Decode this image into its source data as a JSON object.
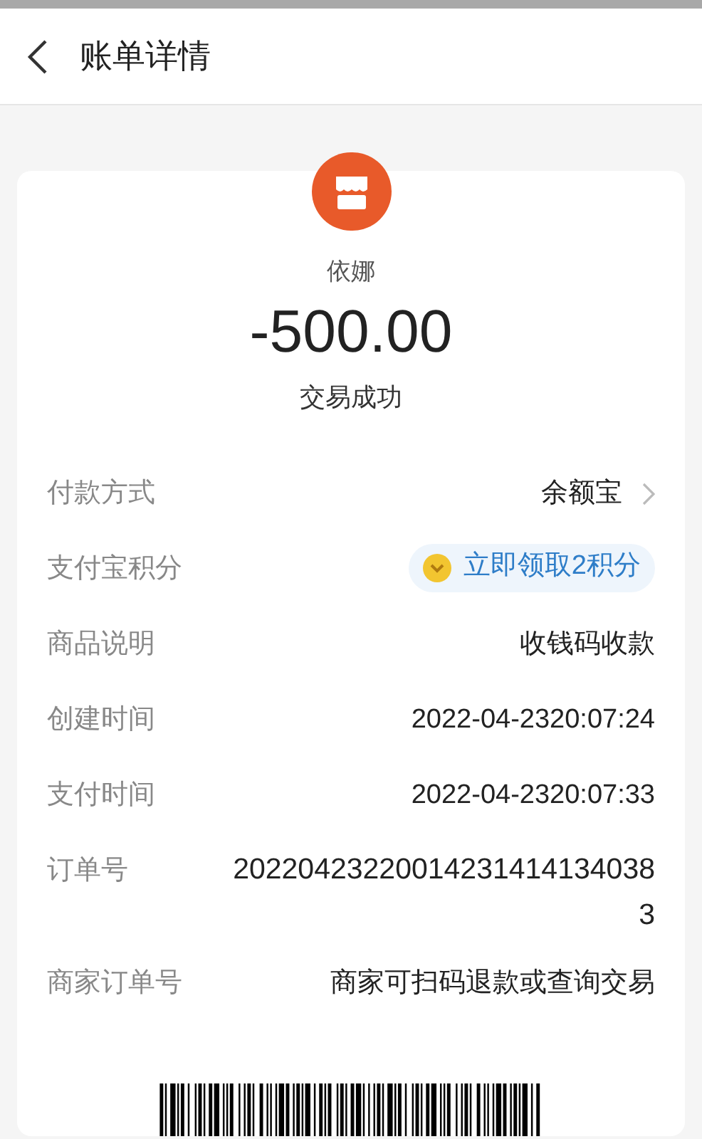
{
  "header": {
    "title": "账单详情"
  },
  "summary": {
    "merchant": "依娜",
    "amount": "-500.00",
    "status": "交易成功"
  },
  "details": [
    {
      "kind": "link",
      "label": "付款方式",
      "value": "余额宝"
    },
    {
      "kind": "points",
      "label": "支付宝积分",
      "value": "立即领取2积分"
    },
    {
      "kind": "text",
      "label": "商品说明",
      "value": "收钱码收款"
    },
    {
      "kind": "text",
      "label": "创建时间",
      "value": "2022-04-2320:07:24"
    },
    {
      "kind": "text",
      "label": "支付时间",
      "value": "2022-04-2320:07:33"
    },
    {
      "kind": "wrap",
      "label": "订单号",
      "value": "202204232200142314141340383"
    },
    {
      "kind": "text",
      "label": "商家订单号",
      "value": "商家可扫码退款或查询交易"
    }
  ]
}
